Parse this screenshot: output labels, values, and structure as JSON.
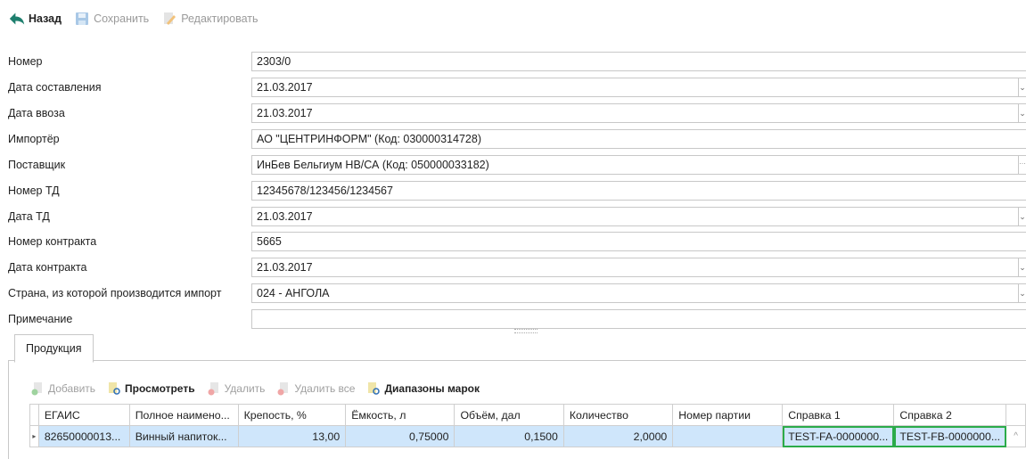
{
  "toolbar": {
    "back": "Назад",
    "save": "Сохранить",
    "edit": "Редактировать"
  },
  "form": {
    "number": {
      "label": "Номер",
      "value": "2303/0"
    },
    "date_created": {
      "label": "Дата составления",
      "value": "21.03.2017"
    },
    "date_import": {
      "label": "Дата ввоза",
      "value": "21.03.2017"
    },
    "importer": {
      "label": "Импортёр",
      "value": "АО \"ЦЕНТРИНФОРМ\" (Код: 030000314728)"
    },
    "supplier": {
      "label": "Поставщик",
      "value": "ИнБев Бельгиум НВ/СА (Код: 050000033182)"
    },
    "td_number": {
      "label": "Номер ТД",
      "value": "12345678/123456/1234567"
    },
    "td_date": {
      "label": "Дата ТД",
      "value": "21.03.2017"
    },
    "contract_number": {
      "label": "Номер контракта",
      "value": "5665"
    },
    "contract_date": {
      "label": "Дата контракта",
      "value": "21.03.2017"
    },
    "country": {
      "label": "Страна, из которой производится импорт",
      "value": "024 - АНГОЛА"
    },
    "note": {
      "label": "Примечание",
      "value": ""
    }
  },
  "tabs": {
    "products": "Продукция"
  },
  "products_toolbar": {
    "add": "Добавить",
    "view": "Просмотреть",
    "delete": "Удалить",
    "delete_all": "Удалить все",
    "stamp_ranges": "Диапазоны марок"
  },
  "grid": {
    "headers": [
      "ЕГАИС",
      "Полное наимено...",
      "Крепость, %",
      "Ёмкость, л",
      "Объём, дал",
      "Количество",
      "Номер партии",
      "Справка 1",
      "Справка 2"
    ],
    "rows": [
      [
        "82650000013...",
        "Винный напиток...",
        "13,00",
        "0,75000",
        "0,1500",
        "2,0000",
        "",
        "TEST-FA-0000000...",
        "TEST-FB-0000000..."
      ]
    ]
  },
  "colors": {
    "highlight": "#2bab4a",
    "selected_row": "#cfe6fb",
    "back_icon": "#1e7f6e"
  }
}
